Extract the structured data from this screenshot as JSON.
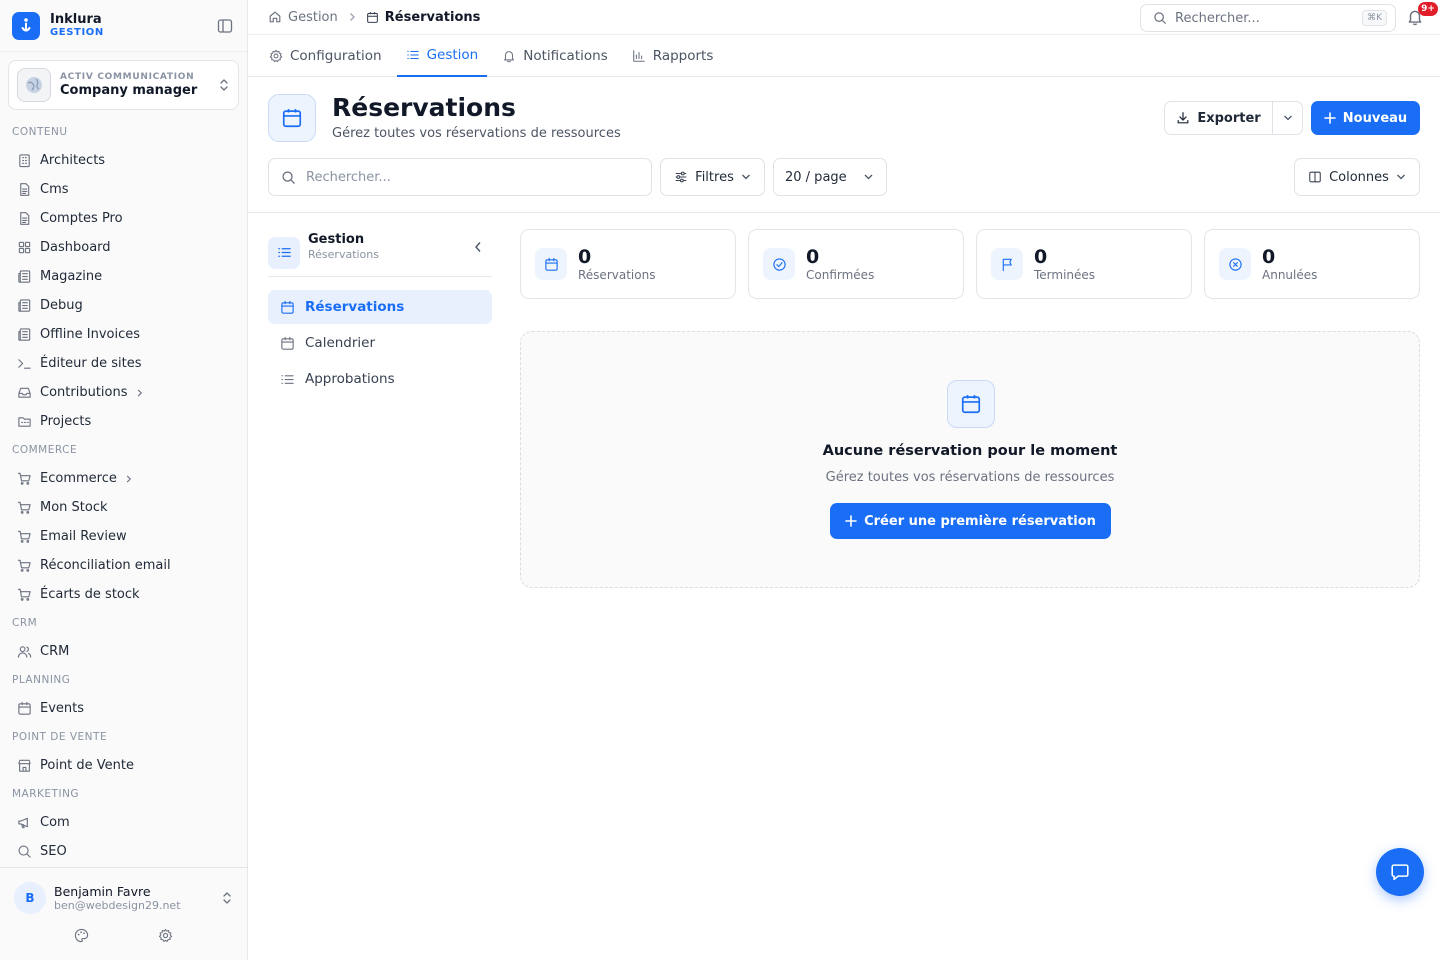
{
  "brand": {
    "name": "Inklura",
    "sub": "GESTION",
    "accent": "#1a6ef5"
  },
  "company": {
    "org": "ACTIV COMMUNICATION",
    "role": "Company manager"
  },
  "sidebar": {
    "sections": [
      {
        "title": "CONTENU",
        "items": [
          {
            "label": "Architects",
            "icon": "building-icon"
          },
          {
            "label": "Cms",
            "icon": "file-icon"
          },
          {
            "label": "Comptes Pro",
            "icon": "file-icon"
          },
          {
            "label": "Dashboard",
            "icon": "grid-icon"
          },
          {
            "label": "Magazine",
            "icon": "newspaper-icon"
          },
          {
            "label": "Debug",
            "icon": "newspaper-icon"
          },
          {
            "label": "Offline Invoices",
            "icon": "newspaper-icon"
          },
          {
            "label": "Éditeur de sites",
            "icon": "terminal-icon"
          },
          {
            "label": "Contributions",
            "icon": "inbox-icon",
            "has_children": true
          },
          {
            "label": "Projects",
            "icon": "folder-icon"
          }
        ]
      },
      {
        "title": "COMMERCE",
        "items": [
          {
            "label": "Ecommerce",
            "icon": "cart-icon",
            "has_children": true
          },
          {
            "label": "Mon Stock",
            "icon": "cart-icon"
          },
          {
            "label": "Email Review",
            "icon": "cart-icon"
          },
          {
            "label": "Réconciliation email",
            "icon": "cart-icon"
          },
          {
            "label": "Écarts de stock",
            "icon": "cart-icon"
          }
        ]
      },
      {
        "title": "CRM",
        "items": [
          {
            "label": "CRM",
            "icon": "users-icon"
          }
        ]
      },
      {
        "title": "PLANNING",
        "items": [
          {
            "label": "Events",
            "icon": "calendar-icon"
          }
        ]
      },
      {
        "title": "POINT DE VENTE",
        "items": [
          {
            "label": "Point de Vente",
            "icon": "store-icon"
          }
        ]
      },
      {
        "title": "MARKETING",
        "items": [
          {
            "label": "Com",
            "icon": "megaphone-icon"
          },
          {
            "label": "SEO",
            "icon": "search-icon"
          }
        ]
      }
    ]
  },
  "user": {
    "initial": "B",
    "name": "Benjamin Favre",
    "email": "ben@webdesign29.net"
  },
  "breadcrumb": {
    "home": "Gestion",
    "current": "Réservations"
  },
  "global_search": {
    "placeholder": "Rechercher...",
    "shortcut": "⌘K"
  },
  "notifications": {
    "badge": "9+"
  },
  "tabs": [
    {
      "label": "Configuration",
      "icon": "gear-icon",
      "active": false
    },
    {
      "label": "Gestion",
      "icon": "list-icon",
      "active": true
    },
    {
      "label": "Notifications",
      "icon": "bell-icon",
      "active": false
    },
    {
      "label": "Rapports",
      "icon": "bar-chart-icon",
      "active": false
    }
  ],
  "page": {
    "title": "Réservations",
    "subtitle": "Gérez toutes vos réservations de ressources"
  },
  "actions": {
    "export_label": "Exporter",
    "new_label": "Nouveau"
  },
  "toolbar": {
    "search_placeholder": "Rechercher...",
    "filters_label": "Filtres",
    "per_page": "20 / page",
    "columns_label": "Colonnes"
  },
  "subnav": {
    "title": "Gestion",
    "subtitle": "Réservations",
    "items": [
      {
        "label": "Réservations",
        "icon": "calendar-icon",
        "active": true
      },
      {
        "label": "Calendrier",
        "icon": "calendar-icon",
        "active": false
      },
      {
        "label": "Approbations",
        "icon": "list-icon",
        "active": false
      }
    ]
  },
  "stats": [
    {
      "value": "0",
      "label": "Réservations",
      "icon": "calendar-icon"
    },
    {
      "value": "0",
      "label": "Confirmées",
      "icon": "check-circle-icon"
    },
    {
      "value": "0",
      "label": "Terminées",
      "icon": "flag-icon"
    },
    {
      "value": "0",
      "label": "Annulées",
      "icon": "x-circle-icon"
    }
  ],
  "empty_state": {
    "title": "Aucune réservation pour le moment",
    "subtitle": "Gérez toutes vos réservations de ressources",
    "cta": "Créer une première réservation"
  }
}
